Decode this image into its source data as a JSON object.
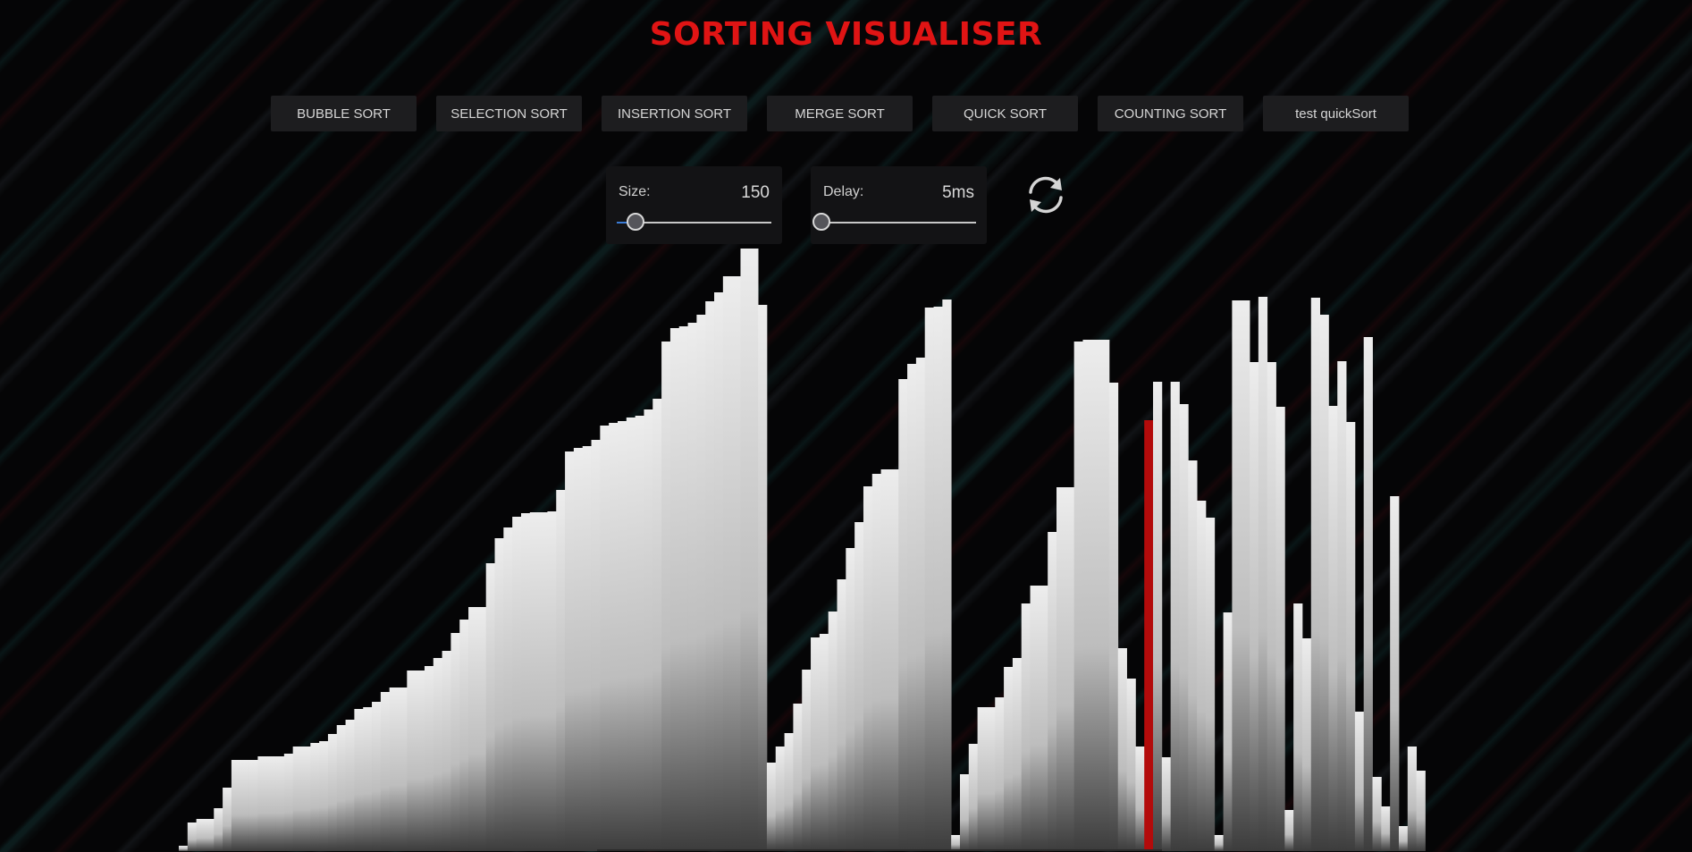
{
  "title": "SORTING VISUALISER",
  "algorithms": [
    {
      "label": "BUBBLE SORT"
    },
    {
      "label": "SELECTION SORT"
    },
    {
      "label": "INSERTION SORT"
    },
    {
      "label": "MERGE SORT"
    },
    {
      "label": "QUICK SORT"
    },
    {
      "label": "COUNTING SORT"
    },
    {
      "label": "test quickSort"
    }
  ],
  "size_control": {
    "label": "Size:",
    "value": "150",
    "slider_fraction": 0.12
  },
  "delay_control": {
    "label": "Delay:",
    "value": "5ms",
    "slider_fraction": 0.0
  },
  "refresh_icon": "refresh-icon",
  "colors": {
    "title": "#e01414",
    "highlight_bar": "#b30b0b",
    "bar_top": "#ececec",
    "bar_bottom": "#4a4a4a"
  },
  "array": {
    "highlight_index": 110,
    "values": [
      6,
      32,
      36,
      36,
      48,
      71,
      102,
      102,
      102,
      106,
      106,
      106,
      109,
      117,
      117,
      121,
      123,
      131,
      141,
      147,
      159,
      161,
      167,
      178,
      183,
      183,
      202,
      202,
      207,
      216,
      224,
      244,
      259,
      273,
      273,
      322,
      350,
      362,
      374,
      378,
      379,
      379,
      380,
      404,
      447,
      451,
      453,
      460,
      476,
      479,
      481,
      485,
      487,
      494,
      506,
      570,
      585,
      587,
      591,
      600,
      615,
      625,
      643,
      643,
      674,
      674,
      611
    ],
    "values_part2": [
      99,
      117,
      132,
      165,
      203,
      239,
      243,
      268,
      304,
      339,
      368,
      408,
      422,
      427,
      427,
      528,
      545,
      552,
      608,
      609,
      617
    ],
    "values_part3": [
      18,
      86,
      120,
      161,
      161,
      172,
      206,
      216,
      277,
      297,
      297,
      357,
      407,
      407,
      570,
      572,
      572,
      572,
      524,
      227,
      193,
      117,
      482,
      525,
      105,
      525,
      500,
      437,
      392,
      373,
      18,
      267,
      616,
      616,
      547,
      620,
      547,
      497,
      46,
      277,
      238,
      619,
      600,
      498,
      548,
      480,
      156,
      575,
      83,
      50,
      397
    ],
    "values_part4": [
      28,
      117,
      90
    ]
  }
}
